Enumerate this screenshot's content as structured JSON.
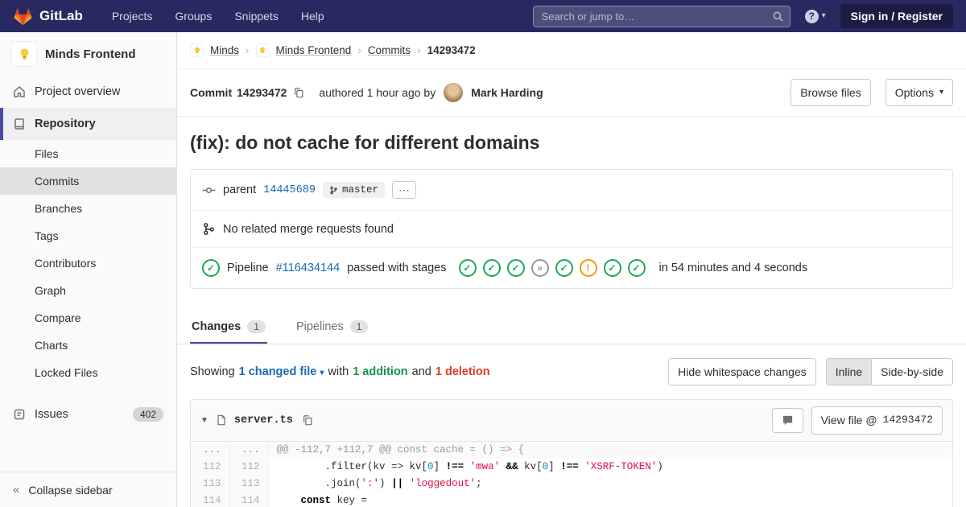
{
  "icons": {
    "caret_down": "▾",
    "crumb_separator": "›",
    "ellipsis": "⋯",
    "collapse_chevron": "«",
    "help_question": "?",
    "file_collapse_caret": "▼",
    "stage_glyphs": {
      "success": "✓",
      "skipped": "»",
      "warning": "!"
    }
  },
  "navbar": {
    "brand": "GitLab",
    "links": [
      {
        "label": "Projects"
      },
      {
        "label": "Groups"
      },
      {
        "label": "Snippets"
      },
      {
        "label": "Help"
      }
    ],
    "search_placeholder": "Search or jump to…",
    "sign_in_label": "Sign in / Register"
  },
  "sidebar": {
    "project_name": "Minds Frontend",
    "overview_label": "Project overview",
    "repository_label": "Repository",
    "repo_items": [
      {
        "label": "Files"
      },
      {
        "label": "Commits",
        "active": true
      },
      {
        "label": "Branches"
      },
      {
        "label": "Tags"
      },
      {
        "label": "Contributors"
      },
      {
        "label": "Graph"
      },
      {
        "label": "Compare"
      },
      {
        "label": "Charts"
      },
      {
        "label": "Locked Files"
      }
    ],
    "issues_label": "Issues",
    "issues_count": "402",
    "collapse_label": "Collapse sidebar"
  },
  "breadcrumb": {
    "group": "Minds",
    "project": "Minds Frontend",
    "section": "Commits",
    "sha": "14293472"
  },
  "commit": {
    "label": "Commit",
    "sha": "14293472",
    "authored_text": "authored 1 hour ago by",
    "author": "Mark Harding",
    "browse_files_label": "Browse files",
    "options_label": "Options",
    "title": "(fix): do not cache for different domains",
    "parent_label": "parent",
    "parent_sha": "14445689",
    "branch": "master",
    "related_mr_text": "No related merge requests found",
    "pipeline_label": "Pipeline",
    "pipeline_id": "#116434144",
    "pipeline_status": "passed with stages",
    "pipeline_duration": "in 54 minutes and 4 seconds",
    "stages": [
      "success",
      "success",
      "success",
      "skipped",
      "success",
      "warning",
      "success",
      "success"
    ]
  },
  "tabs": {
    "changes_label": "Changes",
    "changes_count": "1",
    "pipelines_label": "Pipelines",
    "pipelines_count": "1"
  },
  "diff_bar": {
    "showing": "Showing",
    "changed_file_link": "1 changed file",
    "with_text": "with",
    "addition_text": "1 addition",
    "and_text": "and",
    "deletion_text": "1 deletion",
    "hide_whitespace_label": "Hide whitespace changes",
    "inline_label": "Inline",
    "side_by_side_label": "Side-by-side"
  },
  "file": {
    "name": "server.ts",
    "view_file_prefix": "View file @",
    "view_file_sha": "14293472"
  },
  "diff": {
    "hunk": {
      "old": "...",
      "new": "...",
      "text": "@@ -112,7 +112,7 @@ const cache = () => {"
    },
    "lines": [
      {
        "old": "112",
        "new": "112",
        "tokens": [
          {
            "t": "        .filter(kv => kv[",
            "c": "p"
          },
          {
            "t": "0",
            "c": "num"
          },
          {
            "t": "] ",
            "c": "p"
          },
          {
            "t": "!==",
            "c": "op"
          },
          {
            "t": " ",
            "c": "p"
          },
          {
            "t": "'mwa'",
            "c": "str"
          },
          {
            "t": " ",
            "c": "p"
          },
          {
            "t": "&&",
            "c": "op"
          },
          {
            "t": " kv[",
            "c": "p"
          },
          {
            "t": "0",
            "c": "num"
          },
          {
            "t": "] ",
            "c": "p"
          },
          {
            "t": "!==",
            "c": "op"
          },
          {
            "t": " ",
            "c": "p"
          },
          {
            "t": "'XSRF-TOKEN'",
            "c": "str"
          },
          {
            "t": ")",
            "c": "p"
          }
        ]
      },
      {
        "old": "113",
        "new": "113",
        "tokens": [
          {
            "t": "        .join(",
            "c": "p"
          },
          {
            "t": "':'",
            "c": "str"
          },
          {
            "t": ") ",
            "c": "p"
          },
          {
            "t": "||",
            "c": "op"
          },
          {
            "t": " ",
            "c": "p"
          },
          {
            "t": "'loggedout'",
            "c": "str"
          },
          {
            "t": ";",
            "c": "p"
          }
        ]
      },
      {
        "old": "114",
        "new": "114",
        "tokens": [
          {
            "t": "    ",
            "c": "p"
          },
          {
            "t": "const",
            "c": "kw"
          },
          {
            "t": " key =",
            "c": "p"
          }
        ]
      }
    ]
  }
}
